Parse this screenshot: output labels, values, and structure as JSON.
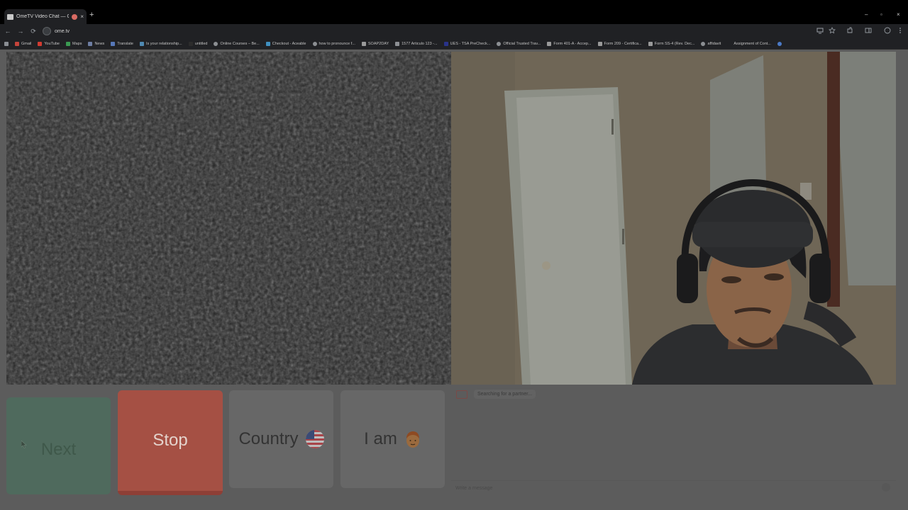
{
  "browser": {
    "tab_title": "OmeTV Video Chat — Ome",
    "tab_close": "×",
    "new_tab": "+",
    "url": "ome.tv",
    "nav": {
      "back": "←",
      "forward": "→",
      "reload": "⟳"
    },
    "window_controls": {
      "minimize": "–",
      "maximize": "▫",
      "close": "×"
    },
    "bookmarks": [
      "Gmail",
      "YouTube",
      "Maps",
      "News",
      "Translate",
      "Is your relationship...",
      "untitled",
      "Online Courses – Be...",
      "Checkout - Aceable",
      "how to pronounce f...",
      "SOAP2DAY",
      "1577 Articulo 123 -...",
      "UES - TSA PreCheck...",
      "Official Trusted Trav...",
      "Form 401-A - Accep...",
      "Form 209 - Certifica...",
      "Form SS-4 (Rev. Dec...",
      "affidavit",
      "Assignment of Cont..."
    ]
  },
  "controls": {
    "next_label": "Next",
    "stop_label": "Stop",
    "country_label": "Country",
    "iam_label": "I am",
    "country_flag_icon": "us-flag-icon",
    "iam_icon": "person-face-icon"
  },
  "chat": {
    "status": "Searching for a partner...",
    "input_placeholder": "Write a message"
  },
  "colors": {
    "next": "#4f6a5d",
    "stop": "#a55044",
    "neutral_button": "#676767",
    "page_overlay": "#5c5c5c"
  }
}
